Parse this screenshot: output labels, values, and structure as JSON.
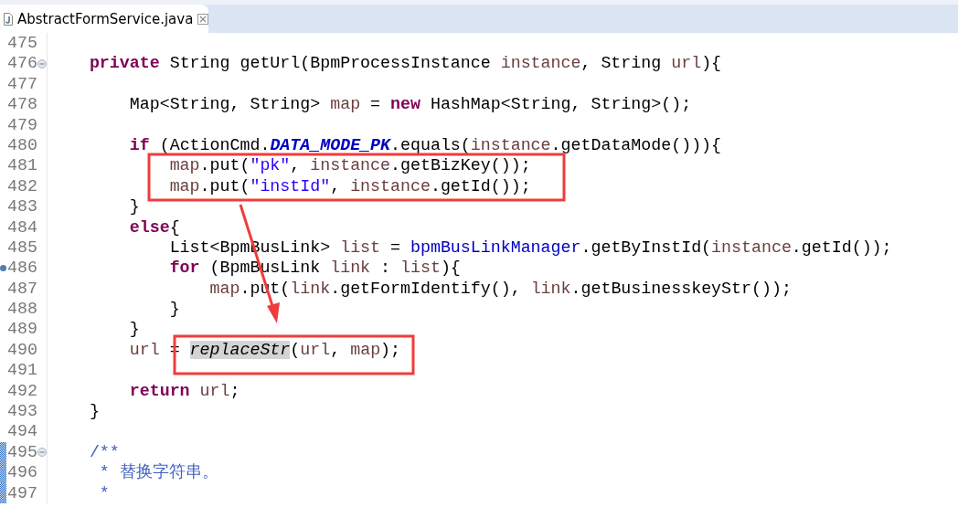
{
  "tab": {
    "title": "AbstractFormService.java",
    "selected": true
  },
  "lines": [
    {
      "number": "475",
      "fold": false,
      "override": false,
      "ranged": false
    },
    {
      "number": "476",
      "fold": true,
      "override": false,
      "ranged": false,
      "tokens": [
        {
          "text": "    private",
          "kind": "keyword"
        },
        {
          "text": " String getUrl(BpmProcessInstance ",
          "kind": "plain"
        },
        {
          "text": "instance",
          "kind": "variable"
        },
        {
          "text": ", String ",
          "kind": "plain"
        },
        {
          "text": "url",
          "kind": "variable"
        },
        {
          "text": "){",
          "kind": "plain"
        }
      ]
    },
    {
      "number": "477",
      "fold": false,
      "override": false,
      "ranged": false
    },
    {
      "number": "478",
      "fold": false,
      "override": false,
      "ranged": false,
      "tokens": [
        {
          "text": "        Map<String, String> ",
          "kind": "plain"
        },
        {
          "text": "map",
          "kind": "variable"
        },
        {
          "text": " = ",
          "kind": "plain"
        },
        {
          "text": "new",
          "kind": "keyword"
        },
        {
          "text": " HashMap<String, String>();",
          "kind": "plain"
        }
      ]
    },
    {
      "number": "479",
      "fold": false,
      "override": false,
      "ranged": false
    },
    {
      "number": "480",
      "fold": false,
      "override": false,
      "ranged": false,
      "tokens": [
        {
          "text": "        if",
          "kind": "keyword"
        },
        {
          "text": " (ActionCmd.",
          "kind": "plain"
        },
        {
          "text": "DATA_MODE_PK",
          "kind": "static_field"
        },
        {
          "text": ".equals(",
          "kind": "plain"
        },
        {
          "text": "instance",
          "kind": "variable"
        },
        {
          "text": ".getDataMode())){",
          "kind": "plain"
        }
      ]
    },
    {
      "number": "481",
      "fold": false,
      "override": false,
      "ranged": false,
      "tokens": [
        {
          "text": "            map",
          "kind": "variable"
        },
        {
          "text": ".put(",
          "kind": "plain"
        },
        {
          "text": "\"pk\"",
          "kind": "string"
        },
        {
          "text": ", ",
          "kind": "plain"
        },
        {
          "text": "instance",
          "kind": "variable"
        },
        {
          "text": ".getBizKey());",
          "kind": "plain"
        }
      ]
    },
    {
      "number": "482",
      "fold": false,
      "override": false,
      "ranged": false,
      "tokens": [
        {
          "text": "            map",
          "kind": "variable"
        },
        {
          "text": ".put(",
          "kind": "plain"
        },
        {
          "text": "\"instId\"",
          "kind": "string"
        },
        {
          "text": ", ",
          "kind": "plain"
        },
        {
          "text": "instance",
          "kind": "variable"
        },
        {
          "text": ".getId());",
          "kind": "plain"
        }
      ]
    },
    {
      "number": "483",
      "fold": false,
      "override": false,
      "ranged": false,
      "tokens": [
        {
          "text": "        }",
          "kind": "plain"
        }
      ]
    },
    {
      "number": "484",
      "fold": false,
      "override": false,
      "ranged": false,
      "tokens": [
        {
          "text": "        else",
          "kind": "keyword"
        },
        {
          "text": "{",
          "kind": "plain"
        }
      ]
    },
    {
      "number": "485",
      "fold": false,
      "override": false,
      "ranged": false,
      "tokens": [
        {
          "text": "            List<BpmBusLink> ",
          "kind": "plain"
        },
        {
          "text": "list",
          "kind": "variable"
        },
        {
          "text": " = ",
          "kind": "plain"
        },
        {
          "text": "bpmBusLinkManager",
          "kind": "field"
        },
        {
          "text": ".getByInstId(",
          "kind": "plain"
        },
        {
          "text": "instance",
          "kind": "variable"
        },
        {
          "text": ".getId());",
          "kind": "plain"
        }
      ]
    },
    {
      "number": "486",
      "fold": false,
      "override": true,
      "ranged": false,
      "tokens": [
        {
          "text": "            for",
          "kind": "keyword"
        },
        {
          "text": " (BpmBusLink ",
          "kind": "plain"
        },
        {
          "text": "link",
          "kind": "variable"
        },
        {
          "text": " : ",
          "kind": "plain"
        },
        {
          "text": "list",
          "kind": "variable"
        },
        {
          "text": "){",
          "kind": "plain"
        }
      ]
    },
    {
      "number": "487",
      "fold": false,
      "override": false,
      "ranged": false,
      "tokens": [
        {
          "text": "                map",
          "kind": "variable"
        },
        {
          "text": ".put(",
          "kind": "plain"
        },
        {
          "text": "link",
          "kind": "variable"
        },
        {
          "text": ".getFormIdentify(), ",
          "kind": "plain"
        },
        {
          "text": "link",
          "kind": "variable"
        },
        {
          "text": ".getBusinesskeyStr());",
          "kind": "plain"
        }
      ]
    },
    {
      "number": "488",
      "fold": false,
      "override": false,
      "ranged": false,
      "tokens": [
        {
          "text": "            }",
          "kind": "plain"
        }
      ]
    },
    {
      "number": "489",
      "fold": false,
      "override": false,
      "ranged": false,
      "tokens": [
        {
          "text": "        }",
          "kind": "plain"
        }
      ]
    },
    {
      "number": "490",
      "fold": false,
      "override": false,
      "ranged": false,
      "tokens": [
        {
          "text": "        url",
          "kind": "variable"
        },
        {
          "text": " = ",
          "kind": "plain"
        },
        {
          "text": "replaceStr",
          "kind": "static_method",
          "highlighted": true
        },
        {
          "text": "(",
          "kind": "plain"
        },
        {
          "text": "url",
          "kind": "variable"
        },
        {
          "text": ", ",
          "kind": "plain"
        },
        {
          "text": "map",
          "kind": "variable"
        },
        {
          "text": ");",
          "kind": "plain"
        }
      ]
    },
    {
      "number": "491",
      "fold": false,
      "override": false,
      "ranged": false
    },
    {
      "number": "492",
      "fold": false,
      "override": false,
      "ranged": false,
      "tokens": [
        {
          "text": "        return",
          "kind": "keyword"
        },
        {
          "text": " url",
          "kind": "variable"
        },
        {
          "text": ";",
          "kind": "plain"
        }
      ]
    },
    {
      "number": "493",
      "fold": false,
      "override": false,
      "ranged": false,
      "tokens": [
        {
          "text": "    }",
          "kind": "plain"
        }
      ]
    },
    {
      "number": "494",
      "fold": false,
      "override": false,
      "ranged": false
    },
    {
      "number": "495",
      "fold": true,
      "override": false,
      "ranged": true,
      "tokens": [
        {
          "text": "    /**",
          "kind": "doc"
        }
      ]
    },
    {
      "number": "496",
      "fold": false,
      "override": false,
      "ranged": true,
      "tokens": [
        {
          "text": "     * 替换字符串。",
          "kind": "doc"
        }
      ]
    },
    {
      "number": "497",
      "fold": false,
      "override": false,
      "ranged": true,
      "tokens": [
        {
          "text": "     *",
          "kind": "doc"
        }
      ]
    }
  ]
}
